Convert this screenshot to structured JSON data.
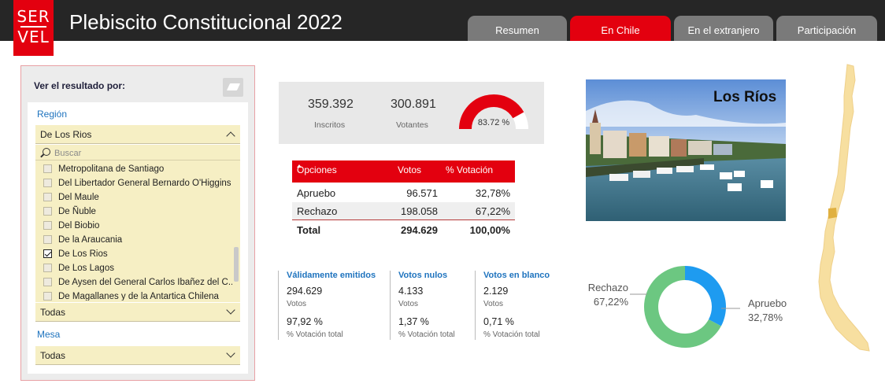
{
  "header": {
    "logo_line1": "SER",
    "logo_line2": "VEL",
    "title": "Plebiscito Constitucional 2022",
    "tabs": [
      {
        "label": "Resumen",
        "active": false
      },
      {
        "label": "En Chile",
        "active": true
      },
      {
        "label": "En el extranjero",
        "active": false
      },
      {
        "label": "Participación",
        "active": false
      }
    ]
  },
  "filters": {
    "heading": "Ver el resultado por:",
    "region_label": "Región",
    "region_selected": "De Los Rios",
    "search_placeholder": "Buscar",
    "region_items": [
      {
        "label": "Metropolitana de Santiago",
        "checked": false
      },
      {
        "label": "Del Libertador General Bernardo O'Higgins",
        "checked": false
      },
      {
        "label": "Del Maule",
        "checked": false
      },
      {
        "label": "De Ñuble",
        "checked": false
      },
      {
        "label": "Del Biobio",
        "checked": false
      },
      {
        "label": "De la Araucania",
        "checked": false
      },
      {
        "label": "De Los Rios",
        "checked": true
      },
      {
        "label": "De Los Lagos",
        "checked": false
      },
      {
        "label": "De Aysen del General Carlos Ibañez del C...",
        "checked": false
      },
      {
        "label": "De Magallanes y de la Antartica Chilena",
        "checked": false
      }
    ],
    "comuna_selected": "Todas",
    "mesa_label": "Mesa",
    "mesa_selected": "Todas"
  },
  "stats": {
    "inscritos_value": "359.392",
    "inscritos_label": "Inscritos",
    "votantes_value": "300.891",
    "votantes_label": "Votantes",
    "participation_label": "83.72 %",
    "participation_fraction": 0.8372
  },
  "results_table": {
    "col_opciones": "Opciones",
    "col_votos": "Votos",
    "col_pct": "% Votación",
    "rows": [
      {
        "option": "Apruebo",
        "votes": "96.571",
        "pct": "32,78%"
      },
      {
        "option": "Rechazo",
        "votes": "198.058",
        "pct": "67,22%"
      }
    ],
    "total": {
      "option": "Total",
      "votes": "294.629",
      "pct": "100,00%"
    }
  },
  "summary": [
    {
      "title": "Válidamente emitidos",
      "votes": "294.629",
      "votes_label": "Votos",
      "pct": "97,92 %",
      "pct_label": "% Votación total"
    },
    {
      "title": "Votos nulos",
      "votes": "4.133",
      "votes_label": "Votos",
      "pct": "1,37 %",
      "pct_label": "% Votación total"
    },
    {
      "title": "Votos en blanco",
      "votes": "2.129",
      "votes_label": "Votos",
      "pct": "0,71 %",
      "pct_label": "% Votación total"
    }
  ],
  "region_photo": {
    "title": "Los Ríos"
  },
  "chart_data": {
    "type": "pie",
    "categories": [
      "Rechazo",
      "Apruebo"
    ],
    "values": [
      67.22,
      32.78
    ],
    "labels": [
      "67,22%",
      "32,78%"
    ],
    "colors": [
      "#6cc781",
      "#1e9bf0"
    ]
  },
  "colors": {
    "brand_red": "#e3000f",
    "tab_gray": "#7a7a7a",
    "accent_blue": "#1e73be",
    "map_fill": "#f7dfa0",
    "map_highlight": "#e0b040"
  }
}
